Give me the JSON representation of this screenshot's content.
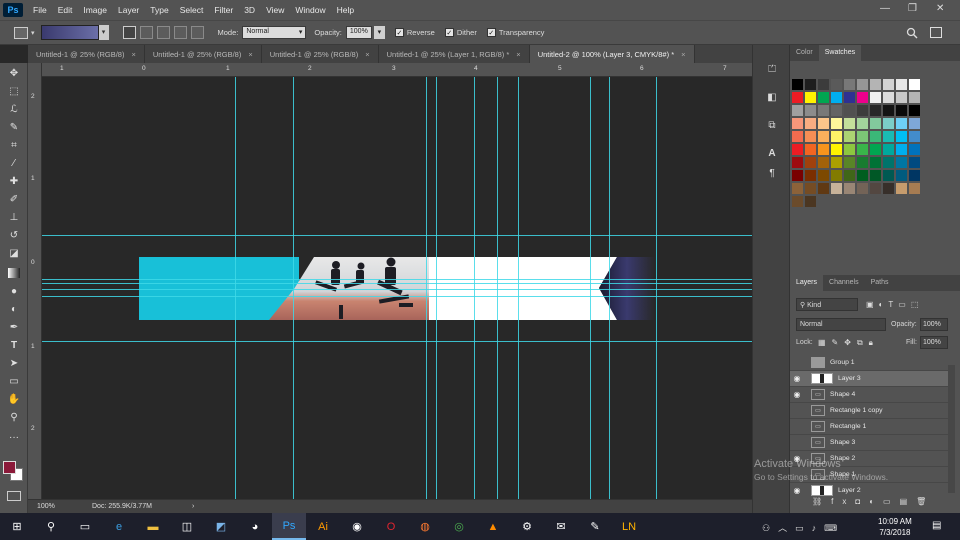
{
  "app": {
    "logo": "Ps"
  },
  "menu": [
    "File",
    "Edit",
    "Image",
    "Layer",
    "Type",
    "Select",
    "Filter",
    "3D",
    "View",
    "Window",
    "Help"
  ],
  "window_controls": {
    "minimize": "—",
    "restore": "❐",
    "close": "✕"
  },
  "options": {
    "mode_label": "Mode:",
    "mode_value": "Normal",
    "opacity_label": "Opacity:",
    "opacity_value": "100%",
    "reverse_label": "Reverse",
    "dither_label": "Dither",
    "transparency_label": "Transparency",
    "check_mark": "✓",
    "dropdown_arrow": "▾"
  },
  "doc_tabs": [
    {
      "label": "Untitled-1 @ 25% (RGB/8)",
      "close": "×"
    },
    {
      "label": "Untitled-1 @ 25% (RGB/8)",
      "close": "×"
    },
    {
      "label": "Untitled-1 @ 25% (RGB/8)",
      "close": "×"
    },
    {
      "label": "Untitled-1 @ 25% (Layer 1, RGB/8) *",
      "close": "×"
    },
    {
      "label": "Untitled-2 @ 100% (Layer 3, CMYK/8#) *",
      "close": "×"
    }
  ],
  "ruler_top": [
    "1",
    "0",
    "1",
    "2",
    "3",
    "4",
    "5",
    "6",
    "7"
  ],
  "ruler_left": [
    "2",
    "1",
    "0",
    "1",
    "2"
  ],
  "status": {
    "zoom": "100%",
    "doc": "Doc: 255.9K/3.77M",
    "arrow": "›"
  },
  "panels": {
    "color_tab": "Color",
    "swatches_tab": "Swatches",
    "layers_tab": "Layers",
    "channels_tab": "Channels",
    "paths_tab": "Paths",
    "kind_label": "Kind",
    "blend_mode": "Normal",
    "opacity_label": "Opacity:",
    "opacity_value": "100%",
    "lock_label": "Lock:",
    "fill_label": "Fill:",
    "fill_value": "100%"
  },
  "layers": [
    {
      "name": "Group 1",
      "visible": false,
      "type": "group"
    },
    {
      "name": "Layer 3",
      "visible": true,
      "type": "pixel",
      "selected": true
    },
    {
      "name": "Shape 4",
      "visible": true,
      "type": "shape"
    },
    {
      "name": "Rectangle 1 copy",
      "visible": false,
      "type": "shape"
    },
    {
      "name": "Rectangle 1",
      "visible": false,
      "type": "shape"
    },
    {
      "name": "Shape 3",
      "visible": false,
      "type": "shape"
    },
    {
      "name": "Shape 2",
      "visible": true,
      "type": "shape"
    },
    {
      "name": "Shape 1",
      "visible": false,
      "type": "shape"
    },
    {
      "name": "Layer 2",
      "visible": true,
      "type": "pixel"
    }
  ],
  "watermark": {
    "title": "Activate Windows",
    "subtitle": "Go to Settings to activate Windows."
  },
  "taskbar": {
    "time": "10:09 AM",
    "date": "7/3/2018"
  },
  "colors": {
    "accent_cyan": "#18c0d8",
    "guide": "#3ed8e8",
    "foreground": "#8b1a3a",
    "background": "#ffffff"
  }
}
